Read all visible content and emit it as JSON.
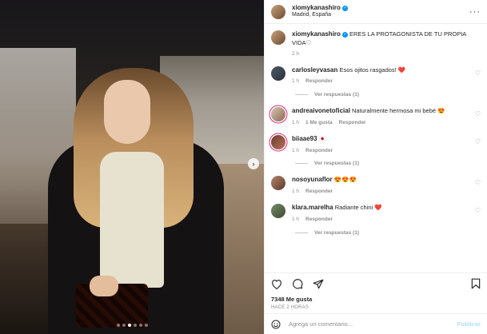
{
  "post": {
    "author": {
      "username": "xiomykanashiro",
      "location": "Madrid, España",
      "verified": true
    },
    "carousel": {
      "slides": 6,
      "active_index": 2
    },
    "caption": {
      "username": "xiomykanashiro",
      "text": "ERES LA PROTAGONISTA DE TU PROPIA VIDA♡",
      "time": "2 h"
    },
    "comments": [
      {
        "username": "carlosleyvasan",
        "text": "Esos ojitos rasgados! ❤️",
        "time": "1 h",
        "likes": "",
        "reply_label": "Responder",
        "view_replies": "Ver respuestas (1)"
      },
      {
        "username": "andreaivonetoficial",
        "text": "Naturalmente hermosa mi bebé 😍",
        "time": "1 h",
        "likes": "1 Me gusta",
        "reply_label": "Responder",
        "view_replies": ""
      },
      {
        "username": "biiaae93",
        "text": "🇯🇵",
        "time": "1 h",
        "likes": "",
        "reply_label": "Responder",
        "view_replies": "Ver respuestas (1)"
      },
      {
        "username": "nosoyunaflor",
        "text": "😍😍😍",
        "time": "1 h",
        "likes": "",
        "reply_label": "Responder",
        "view_replies": ""
      },
      {
        "username": "klara.marelha",
        "text": "Radiante chini ❤️",
        "time": "1 h",
        "likes": "",
        "reply_label": "Responder",
        "view_replies": "Ver respuestas (1)"
      }
    ],
    "likes": "7348 Me gusta",
    "posted": "Hace 2 horas",
    "add_comment": {
      "placeholder": "Agrega un comentario...",
      "publish_label": "Publicar"
    }
  },
  "icons": {
    "more": "more-options-icon",
    "heart": "heart-icon",
    "comment": "comment-icon",
    "share": "share-icon",
    "save": "bookmark-icon",
    "emoji": "emoji-icon",
    "next": "chevron-right-icon"
  },
  "colors": {
    "accent": "#0095f6",
    "publish_disabled": "#b2dffc",
    "muted": "#8e8e8e"
  }
}
